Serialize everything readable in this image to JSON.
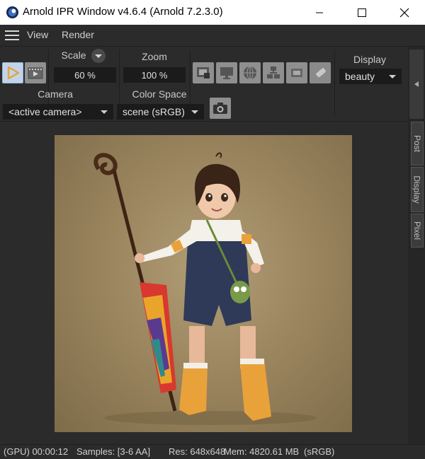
{
  "window": {
    "title": "Arnold IPR Window v4.6.4 (Arnold 7.2.3.0)"
  },
  "menu": {
    "items": [
      "View",
      "Render"
    ]
  },
  "toolbar": {
    "scale_label": "Scale",
    "scale_value": "60 %",
    "zoom_label": "Zoom",
    "zoom_value": "100 %",
    "display_label": "Display",
    "display_value": "beauty",
    "camera_label": "Camera",
    "camera_value": "<active camera>",
    "color_space_label": "Color Space",
    "color_space_value": "scene (sRGB)"
  },
  "side_tabs": [
    "Post",
    "Display",
    "Pixel"
  ],
  "status": {
    "device_time": "(GPU) 00:00:12",
    "samples": "Samples: [3-6 AA]",
    "resolution": "Res: 648x648",
    "memory": "Mem: 4820.61 MB",
    "color_space": "(sRGB)"
  },
  "icons": {
    "app": "cinema4d-icon",
    "render": "play-render-icon",
    "render_sequence": "film-render-icon",
    "snapshot": "camera-icon"
  },
  "colors": {
    "accent": "#e8a23a",
    "button_active": "#c2d4ea",
    "render_bg": "#9b865f"
  }
}
